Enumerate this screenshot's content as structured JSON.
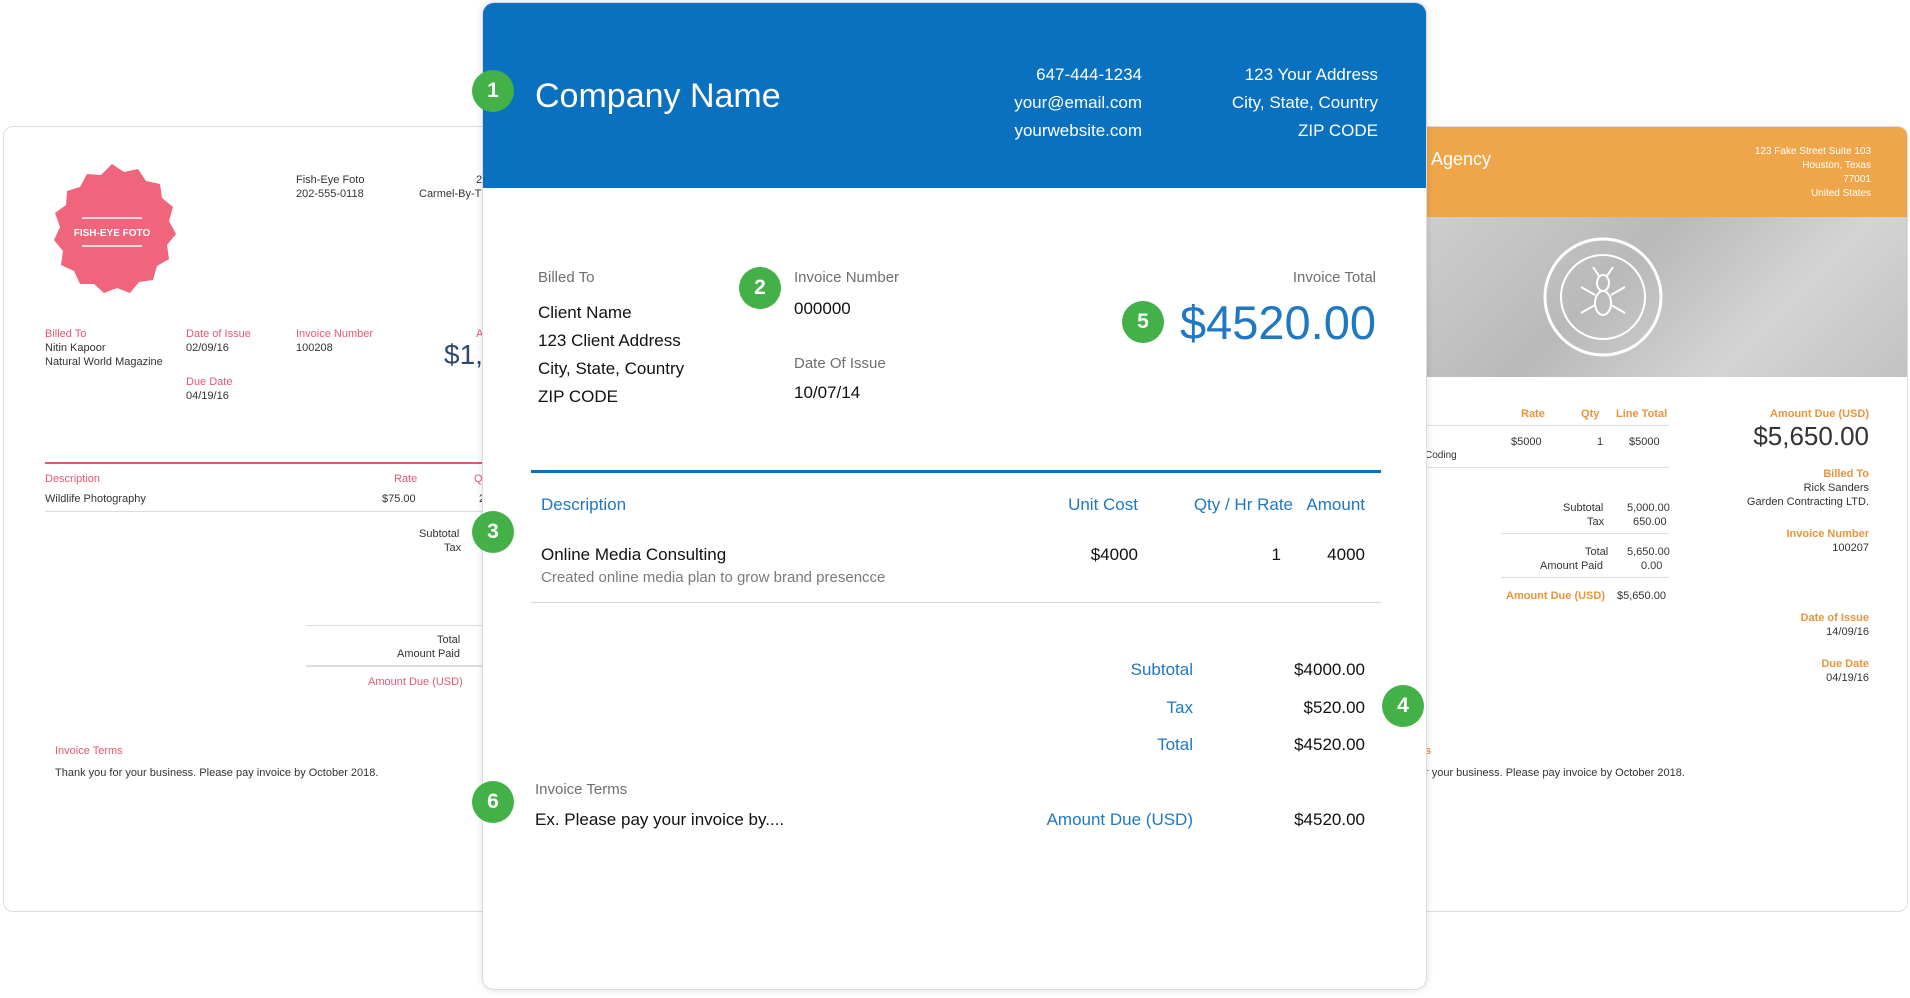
{
  "left_invoice": {
    "logo_text": "FISH-EYE FOTO",
    "company": "Fish-Eye Foto",
    "phone": "202-555-0118",
    "address_num": "2",
    "address_city": "Carmel-By-Th",
    "billed_to_label": "Billed To",
    "client_name": "Nitin Kapoor",
    "client_company": "Natural World Magazine",
    "date_of_issue_label": "Date of Issue",
    "date_of_issue": "02/09/16",
    "due_date_label": "Due Date",
    "due_date": "04/19/16",
    "invoice_number_label": "Invoice Number",
    "invoice_number": "100208",
    "amount_label_fragment": "A",
    "amount_fragment": "$1,",
    "description_label": "Description",
    "rate_label": "Rate",
    "qty_label_fragment": "Qt",
    "item": "Wildlife Photography",
    "item_rate": "$75.00",
    "item_qty_fragment": "2",
    "subtotal_label": "Subtotal",
    "tax_label": "Tax",
    "total_label": "Total",
    "amount_paid_label": "Amount Paid",
    "amount_due_label": "Amount Due (USD)",
    "terms_label": "Invoice Terms",
    "terms_text": "Thank you for your business. Please pay invoice by October 2018."
  },
  "right_invoice": {
    "agency_fragment": "Agency",
    "address_lines": [
      "123 Fake Street Suite 103",
      "Houston, Texas",
      "77001",
      "United States"
    ],
    "rate_label": "Rate",
    "qty_label": "Qty",
    "line_total_label": "Line Total",
    "item_fragment": "Coding",
    "item_rate": "$5000",
    "item_qty": "1",
    "item_total": "$5000",
    "subtotal_label": "Subtotal",
    "subtotal": "5,000.00",
    "tax_label": "Tax",
    "tax": "650.00",
    "total_label": "Total",
    "total": "5,650.00",
    "amount_paid_label": "Amount Paid",
    "amount_paid": "0.00",
    "amount_due_label": "Amount Due (USD)",
    "amount_due": "$5,650.00",
    "amount_due_big_label": "Amount Due (USD)",
    "amount_due_big": "$5,650.00",
    "billed_to_label": "Billed To",
    "client_name": "Rick Sanders",
    "client_company": "Garden Contracting LTD.",
    "invoice_number_label": "Invoice Number",
    "invoice_number": "100207",
    "date_of_issue_label": "Date of Issue",
    "date_of_issue": "14/09/16",
    "due_date_label": "Due Date",
    "due_date": "04/19/16",
    "terms_fragment": "s",
    "terms_text": "r your business. Please pay invoice by October 2018."
  },
  "main_invoice": {
    "company_name": "Company Name",
    "phone": "647-444-1234",
    "email": "your@email.com",
    "website": "yourwebsite.com",
    "address": "123 Your Address",
    "city": "City, State, Country",
    "zip": "ZIP CODE",
    "billed_to_label": "Billed To",
    "client_name": "Client Name",
    "client_address": "123 Client Address",
    "client_city": "City, State, Country",
    "client_zip": "ZIP CODE",
    "invoice_number_label": "Invoice Number",
    "invoice_number": "000000",
    "date_of_issue_label": "Date Of Issue",
    "date_of_issue": "10/07/14",
    "invoice_total_label": "Invoice Total",
    "invoice_total": "$4520.00",
    "columns": {
      "description": "Description",
      "unit_cost": "Unit Cost",
      "qty": "Qty / Hr Rate",
      "amount": "Amount"
    },
    "item": {
      "name": "Online Media Consulting",
      "detail": "Created online media plan to grow brand presencce",
      "unit_cost": "$4000",
      "qty": "1",
      "amount": "4000"
    },
    "subtotal_label": "Subtotal",
    "subtotal": "$4000.00",
    "tax_label": "Tax",
    "tax": "$520.00",
    "total_label": "Total",
    "total": "$4520.00",
    "terms_label": "Invoice Terms",
    "terms_text": "Ex. Please pay your invoice by....",
    "amount_due_label": "Amount Due (USD)",
    "amount_due": "$4520.00"
  },
  "badges": [
    "1",
    "2",
    "3",
    "4",
    "5",
    "6"
  ],
  "colors": {
    "main_blue": "#0a71c0",
    "badge_green": "#43b048",
    "left_pink": "#e35870",
    "right_orange": "#efa64b"
  }
}
